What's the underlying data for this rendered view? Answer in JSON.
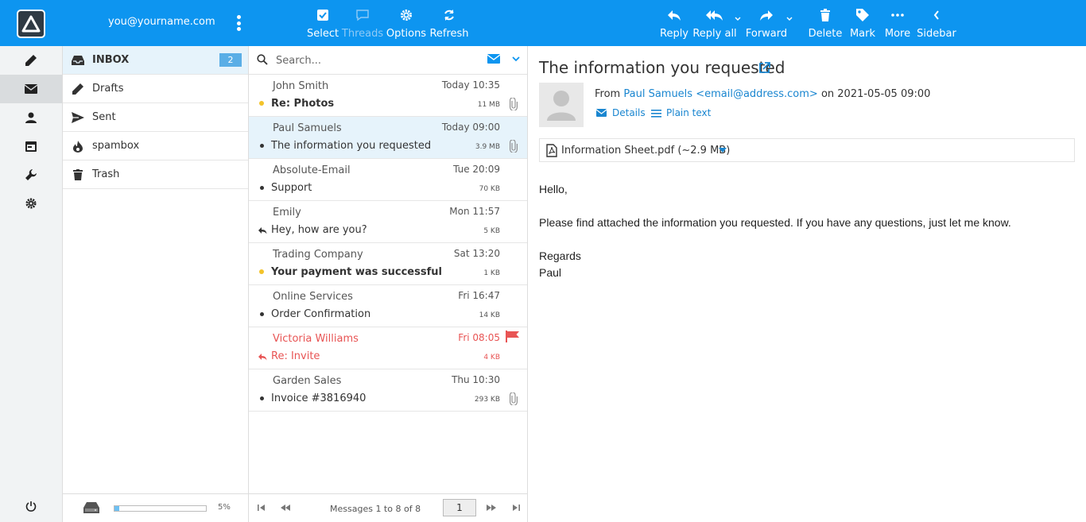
{
  "header": {
    "user_email": "you@yourname.com",
    "toolbar_left": [
      {
        "label": "Select",
        "icon": "checkbox-icon"
      },
      {
        "label": "Threads",
        "icon": "threads-icon",
        "disabled": true
      },
      {
        "label": "Options",
        "icon": "gear-icon"
      },
      {
        "label": "Refresh",
        "icon": "refresh-icon"
      }
    ],
    "toolbar_right": [
      {
        "label": "Reply",
        "icon": "reply-icon"
      },
      {
        "label": "Reply all",
        "icon": "reply-all-icon"
      },
      {
        "label": "Forward",
        "icon": "forward-icon"
      },
      {
        "label": "Delete",
        "icon": "trash-icon"
      },
      {
        "label": "Mark",
        "icon": "tag-icon"
      },
      {
        "label": "More",
        "icon": "more-icon"
      },
      {
        "label": "Sidebar",
        "icon": "chevron-left-icon"
      }
    ]
  },
  "colors": {
    "header_bg": "#0d95f0",
    "accent": "#1a86d0",
    "unread_dot": "#f3c32a",
    "flagged": "#e85454"
  },
  "folders": [
    {
      "name": "INBOX",
      "icon": "inbox-icon",
      "badge": "2",
      "active": true
    },
    {
      "name": "Drafts",
      "icon": "pencil-icon"
    },
    {
      "name": "Sent",
      "icon": "send-icon"
    },
    {
      "name": "spambox",
      "icon": "fire-icon"
    },
    {
      "name": "Trash",
      "icon": "trash-icon"
    }
  ],
  "quota": {
    "percent_label": "5%",
    "fraction": 0.05
  },
  "search": {
    "placeholder": "Search..."
  },
  "messages": [
    {
      "from": "John Smith",
      "date": "Today 10:35",
      "subject": "Re: Photos",
      "size": "11 MB",
      "unread": true,
      "attachment": true
    },
    {
      "from": "Paul Samuels",
      "date": "Today 09:00",
      "subject": "The information you requested",
      "size": "3.9 MB",
      "attachment": true,
      "selected": true
    },
    {
      "from": "Absolute-Email",
      "date": "Tue 20:09",
      "subject": "Support",
      "size": "70 KB"
    },
    {
      "from": "Emily",
      "date": "Mon 11:57",
      "subject": "Hey, how are you?",
      "size": "5 KB",
      "replied": true
    },
    {
      "from": "Trading Company",
      "date": "Sat 13:20",
      "subject": "Your payment was successful",
      "size": "1 KB",
      "unread": true
    },
    {
      "from": "Online Services",
      "date": "Fri 16:47",
      "subject": "Order Confirmation",
      "size": "14 KB"
    },
    {
      "from": "Victoria Williams",
      "date": "Fri 08:05",
      "subject": "Re: Invite",
      "size": "4 KB",
      "replied": true,
      "flagged": true
    },
    {
      "from": "Garden Sales",
      "date": "Thu 10:30",
      "subject": "Invoice #3816940",
      "size": "293 KB",
      "attachment": true
    }
  ],
  "pager": {
    "text": "Messages 1 to 8 of 8",
    "page": "1"
  },
  "reader": {
    "subject": "The information you requested",
    "from_prefix": "From",
    "from_link": "Paul Samuels <email@address.com>",
    "from_suffix": "on 2021-05-05 09:00",
    "details_label": "Details",
    "plain_label": "Plain text",
    "attachment": "Information Sheet.pdf (~2.9 MB)",
    "body": [
      "Hello,",
      "Please find attached the information you requested. If you have any questions, just let me know.",
      "Regards",
      "Paul"
    ]
  }
}
